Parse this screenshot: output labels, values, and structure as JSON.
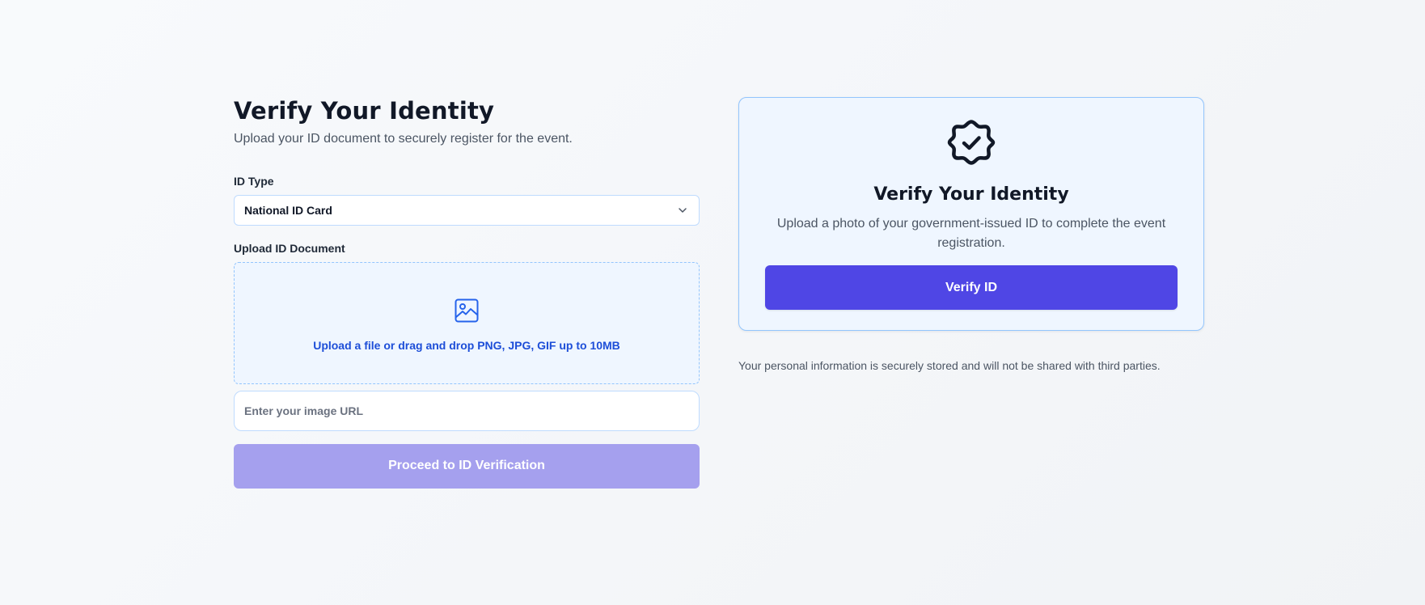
{
  "form": {
    "title": "Verify Your Identity",
    "subtitle": "Upload your ID document to securely register for the event.",
    "id_type_label": "ID Type",
    "id_type_value": "National ID Card",
    "upload_label": "Upload ID Document",
    "dropzone_text": "Upload a file or drag and drop PNG, JPG, GIF up to 10MB",
    "url_placeholder": "Enter your image URL",
    "url_value": "",
    "proceed_label": "Proceed to ID Verification",
    "proceed_disabled": true
  },
  "card": {
    "title": "Verify Your Identity",
    "description": "Upload a photo of your government-issued ID to complete the event registration.",
    "button_label": "Verify ID",
    "icon": "badge-check-icon"
  },
  "privacy_note": "Your personal information is securely stored and will not be shared with third parties.",
  "colors": {
    "accent": "#4f46e5",
    "accent_disabled": "#a5a0ee",
    "link_blue": "#1d4ed8",
    "card_bg": "#eff6ff",
    "border_blue": "#93c5fd"
  },
  "icons": {
    "select_chevron": "chevron-down-icon",
    "dropzone": "image-icon"
  }
}
